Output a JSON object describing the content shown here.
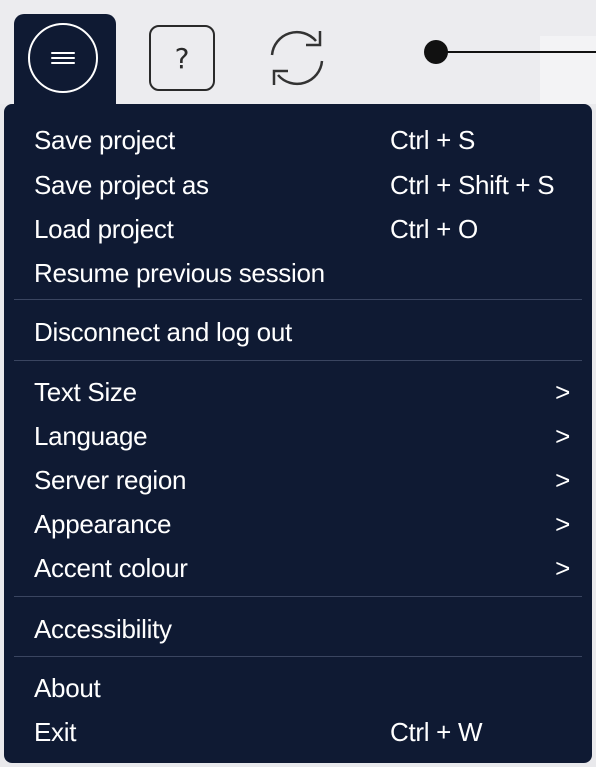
{
  "toolbar": {
    "help_label": "?",
    "icons": {
      "menu": "hamburger-menu-icon",
      "help": "question-mark-icon",
      "refresh": "refresh-icon"
    }
  },
  "menu": {
    "sections": [
      {
        "items": [
          {
            "label": "Save project",
            "shortcut": "Ctrl + S"
          },
          {
            "label": "Save project as",
            "shortcut": "Ctrl + Shift + S"
          },
          {
            "label": "Load project",
            "shortcut": "Ctrl + O"
          },
          {
            "label": "Resume previous session",
            "shortcut": ""
          }
        ]
      },
      {
        "items": [
          {
            "label": "Disconnect and log out",
            "shortcut": ""
          }
        ]
      },
      {
        "items": [
          {
            "label": "Text Size",
            "submenu": ">"
          },
          {
            "label": "Language",
            "submenu": ">"
          },
          {
            "label": "Server region",
            "submenu": ">"
          },
          {
            "label": "Appearance",
            "submenu": ">"
          },
          {
            "label": "Accent colour",
            "submenu": ">"
          }
        ]
      },
      {
        "items": [
          {
            "label": "Accessibility",
            "shortcut": ""
          }
        ]
      },
      {
        "items": [
          {
            "label": "About",
            "shortcut": ""
          },
          {
            "label": "Exit",
            "shortcut": "Ctrl + W"
          }
        ]
      }
    ]
  },
  "colors": {
    "menu_background": "#0f1a33",
    "menu_text": "#ffffff",
    "divider": "#3a4560",
    "toolbar_background": "#ececef"
  }
}
